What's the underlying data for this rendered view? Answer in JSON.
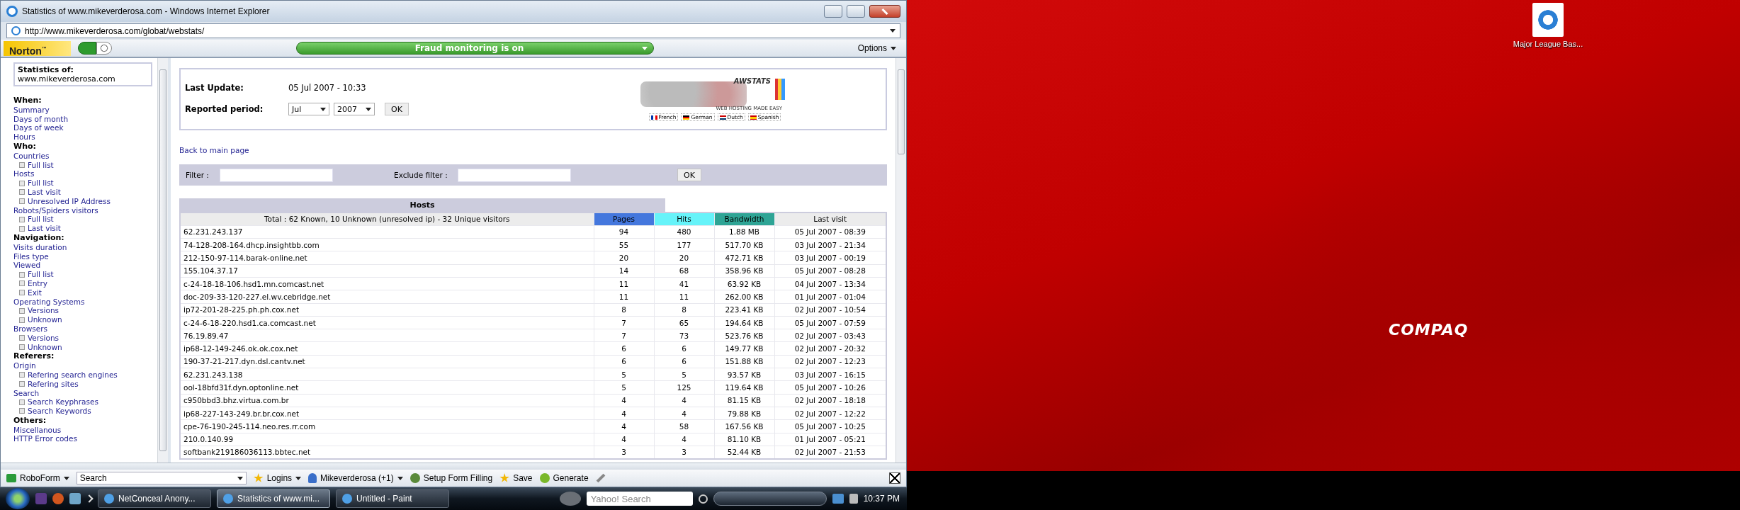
{
  "window": {
    "title": "Statistics of www.mikeverderosa.com - Windows Internet Explorer"
  },
  "address_bar": {
    "url": "http://www.mikeverderosa.com/globat/webstats/"
  },
  "norton_toolbar": {
    "brand": "Norton$^{™}$",
    "status": "Fraud monitoring is on",
    "options": "Options"
  },
  "sidebar": {
    "heading": "Statistics of:",
    "site": "www.mikeverderosa.com",
    "sections": [
      {
        "title": "When:",
        "items": [
          {
            "label": "Summary"
          },
          {
            "label": "Days of month"
          },
          {
            "label": "Days of week"
          },
          {
            "label": "Hours"
          }
        ]
      },
      {
        "title": "Who:",
        "items": [
          {
            "label": "Countries",
            "children": [
              {
                "label": "Full list"
              }
            ]
          },
          {
            "label": "Hosts",
            "children": [
              {
                "label": "Full list"
              },
              {
                "label": "Last visit"
              },
              {
                "label": "Unresolved IP Address"
              }
            ]
          },
          {
            "label": "Robots/Spiders visitors",
            "children": [
              {
                "label": "Full list"
              },
              {
                "label": "Last visit"
              }
            ]
          }
        ]
      },
      {
        "title": "Navigation:",
        "items": [
          {
            "label": "Visits duration"
          },
          {
            "label": "Files type"
          },
          {
            "label": "Viewed",
            "children": [
              {
                "label": "Full list"
              },
              {
                "label": "Entry"
              },
              {
                "label": "Exit"
              }
            ]
          },
          {
            "label": "Operating Systems",
            "children": [
              {
                "label": "Versions"
              },
              {
                "label": "Unknown"
              }
            ]
          },
          {
            "label": "Browsers",
            "children": [
              {
                "label": "Versions"
              },
              {
                "label": "Unknown"
              }
            ]
          }
        ]
      },
      {
        "title": "Referers:",
        "items": [
          {
            "label": "Origin",
            "children": [
              {
                "label": "Refering search engines"
              },
              {
                "label": "Refering sites"
              }
            ]
          },
          {
            "label": "Search",
            "children": [
              {
                "label": "Search Keyphrases"
              },
              {
                "label": "Search Keywords"
              }
            ]
          }
        ]
      },
      {
        "title": "Others:",
        "items": [
          {
            "label": "Miscellanous"
          },
          {
            "label": "HTTP Error codes"
          }
        ]
      }
    ]
  },
  "header": {
    "last_update_label": "Last Update:",
    "last_update_value": "05 Jul 2007 - 10:33",
    "period_label": "Reported period:",
    "month": "Jul",
    "year": "2007",
    "ok": "OK",
    "logo": {
      "name": "AWSTATS",
      "tagline": "WEB HOSTING MADE EASY"
    },
    "languages": [
      "French",
      "German",
      "Dutch",
      "Spanish"
    ]
  },
  "back_link": "Back to main page",
  "filter": {
    "label": "Filter :",
    "exclude_label": "Exclude filter :",
    "ok": "OK"
  },
  "hosts_table": {
    "title": "Hosts",
    "columns": [
      {
        "label": "Total : 62 Known, 10 Unknown (unresolved ip) - 32 Unique visitors"
      },
      {
        "label": "Pages",
        "color": "#4477dd"
      },
      {
        "label": "Hits",
        "color": "#66f3f9"
      },
      {
        "label": "Bandwidth",
        "color": "#2ea495"
      },
      {
        "label": "Last visit"
      }
    ],
    "rows": [
      [
        "62.231.243.137",
        "94",
        "480",
        "1.88 MB",
        "05 Jul 2007 - 08:39"
      ],
      [
        "74-128-208-164.dhcp.insightbb.com",
        "55",
        "177",
        "517.70 KB",
        "03 Jul 2007 - 21:34"
      ],
      [
        "212-150-97-114.barak-online.net",
        "20",
        "20",
        "472.71 KB",
        "03 Jul 2007 - 00:19"
      ],
      [
        "155.104.37.17",
        "14",
        "68",
        "358.96 KB",
        "05 Jul 2007 - 08:28"
      ],
      [
        "c-24-18-18-106.hsd1.mn.comcast.net",
        "11",
        "41",
        "63.92 KB",
        "04 Jul 2007 - 13:34"
      ],
      [
        "doc-209-33-120-227.el.wv.cebridge.net",
        "11",
        "11",
        "262.00 KB",
        "01 Jul 2007 - 01:04"
      ],
      [
        "ip72-201-28-225.ph.ph.cox.net",
        "8",
        "8",
        "223.41 KB",
        "02 Jul 2007 - 10:54"
      ],
      [
        "c-24-6-18-220.hsd1.ca.comcast.net",
        "7",
        "65",
        "194.64 KB",
        "05 Jul 2007 - 07:59"
      ],
      [
        "76.19.89.47",
        "7",
        "73",
        "523.76 KB",
        "02 Jul 2007 - 03:43"
      ],
      [
        "ip68-12-149-246.ok.ok.cox.net",
        "6",
        "6",
        "149.77 KB",
        "02 Jul 2007 - 20:32"
      ],
      [
        "190-37-21-217.dyn.dsl.cantv.net",
        "6",
        "6",
        "151.88 KB",
        "02 Jul 2007 - 12:23"
      ],
      [
        "62.231.243.138",
        "5",
        "5",
        "93.57 KB",
        "03 Jul 2007 - 16:15"
      ],
      [
        "ool-18bfd31f.dyn.optonline.net",
        "5",
        "125",
        "119.64 KB",
        "05 Jul 2007 - 10:26"
      ],
      [
        "c950bbd3.bhz.virtua.com.br",
        "4",
        "4",
        "81.15 KB",
        "02 Jul 2007 - 18:18"
      ],
      [
        "ip68-227-143-249.br.br.cox.net",
        "4",
        "4",
        "79.88 KB",
        "02 Jul 2007 - 12:22"
      ],
      [
        "cpe-76-190-245-114.neo.res.rr.com",
        "4",
        "58",
        "167.56 KB",
        "05 Jul 2007 - 10:25"
      ],
      [
        "210.0.140.99",
        "4",
        "4",
        "81.10 KB",
        "01 Jul 2007 - 05:21"
      ],
      [
        "softbank219186036113.bbtec.net",
        "3",
        "3",
        "52.44 KB",
        "02 Jul 2007 - 21:53"
      ]
    ]
  },
  "roboform": {
    "brand": "RoboForm",
    "search": "Search",
    "items": [
      "Logins",
      "Mikeverderosa (+1)",
      "Setup Form Filling",
      "Save",
      "Generate"
    ]
  },
  "taskbar": {
    "tasks": [
      {
        "label": "NetConceal Anony...",
        "selected": false
      },
      {
        "label": "Statistics of www.mi...",
        "selected": true
      },
      {
        "label": "Untitled - Paint",
        "selected": false
      }
    ],
    "search_placeholder": "Yahoo! Search",
    "clock": "10:37 PM"
  },
  "desktop": {
    "icon_label": "Major League Bas...",
    "brand": "COMPAQ"
  }
}
